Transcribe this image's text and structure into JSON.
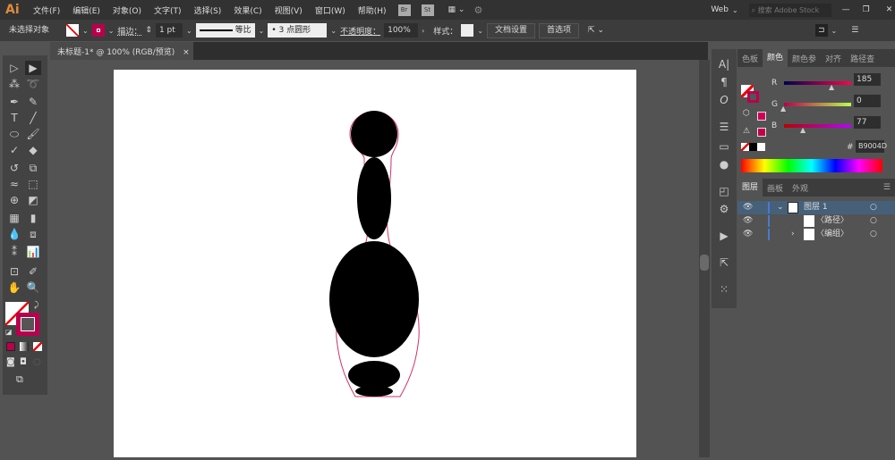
{
  "app": {
    "logo": "Ai",
    "menus": [
      "文件(F)",
      "编辑(E)",
      "对象(O)",
      "文字(T)",
      "选择(S)",
      "效果(C)",
      "视图(V)",
      "窗口(W)",
      "帮助(H)"
    ],
    "bridge": "Br",
    "stock": "St",
    "workspace": "Web",
    "search_placeholder": "搜索 Adobe Stock"
  },
  "control": {
    "selection": "未选择对象",
    "stroke_label": "描边：",
    "stroke_weight": "1 pt",
    "profile": "等比",
    "brush": "3 点圆形",
    "opacity_label": "不透明度：",
    "opacity": "100%",
    "style_label": "样式：",
    "doc_setup": "文档设置",
    "preferences": "首选项"
  },
  "document": {
    "tab": "未标题-1* @ 100% (RGB/预览)",
    "close": "×"
  },
  "color_panel": {
    "tabs": [
      "色板",
      "颜色",
      "颜色参",
      "对齐",
      "路径查"
    ],
    "active_tab": "颜色",
    "r_label": "R",
    "g_label": "G",
    "b_label": "B",
    "r": "185",
    "g": "0",
    "b": "77",
    "hex_label": "#",
    "hex": "B9004D",
    "stroke_color": "#B9004D"
  },
  "layers_panel": {
    "tabs": [
      "图层",
      "画板",
      "外观"
    ],
    "rows": [
      {
        "name": "图层 1"
      },
      {
        "name": "〈路径〉"
      },
      {
        "name": "〈编组〉"
      }
    ]
  }
}
